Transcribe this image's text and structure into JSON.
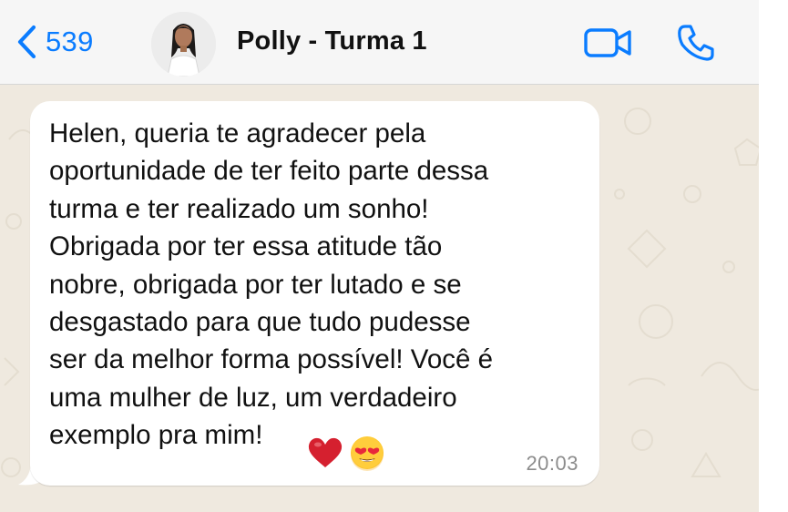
{
  "header": {
    "back_count": "539",
    "contact_name": "Polly - Turma 1"
  },
  "message": {
    "text": "Helen, queria te agradecer pela\noportunidade de ter feito parte dessa\nturma e ter realizado um sonho!\nObrigada por ter essa atitude tão\nnobre, obrigada por ter lutado e se\ndesgastado para que tudo pudesse\nser da melhor forma possível! Você é\numa mulher de luz, um verdadeiro\nexemplo pra mim!",
    "emojis": [
      "heart-emoji",
      "heart-eyes-emoji"
    ],
    "time": "20:03"
  },
  "colors": {
    "accent": "#0a7cff",
    "header_bg": "#f6f6f6",
    "chat_bg": "#efe9df",
    "bubble_bg": "#ffffff",
    "heart": "#d5202f",
    "emoji_face": "#ffcc33"
  }
}
